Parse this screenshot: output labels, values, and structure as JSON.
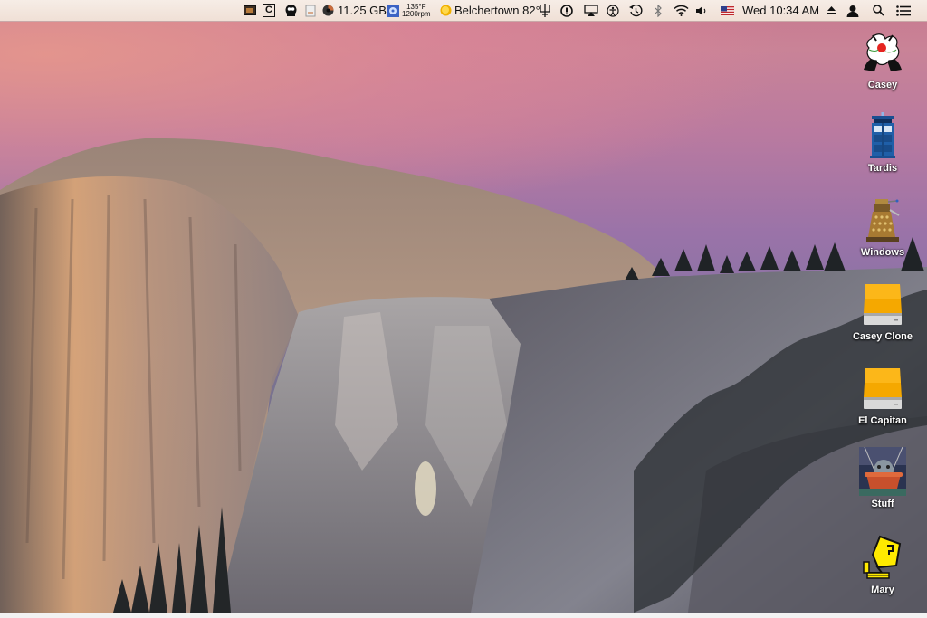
{
  "menubar": {
    "status_items": [
      {
        "name": "photo-app-icon"
      },
      {
        "name": "c-app-icon",
        "glyph": "C"
      },
      {
        "name": "monster-app-icon"
      },
      {
        "name": "document-app-icon"
      },
      {
        "name": "disk-usage-icon",
        "text": "11.25 GB"
      },
      {
        "name": "fan-icon",
        "temp": "135°F",
        "rpm": "1200rpm"
      },
      {
        "name": "weather-sun-icon",
        "text": "Belchertown 82°"
      },
      {
        "name": "ruler-app-icon"
      },
      {
        "name": "info-circle-icon"
      },
      {
        "name": "airplay-icon"
      },
      {
        "name": "accessibility-icon"
      },
      {
        "name": "time-machine-icon"
      },
      {
        "name": "bluetooth-icon"
      },
      {
        "name": "wifi-icon"
      },
      {
        "name": "volume-icon"
      },
      {
        "name": "us-flag-input-icon"
      }
    ],
    "clock": "Wed 10:34 AM",
    "eject_icon": "eject-icon",
    "user_icon": "user-icon",
    "spotlight_icon": "spotlight-search-icon",
    "notification_icon": "notification-center-icon"
  },
  "desktop": {
    "icons": [
      {
        "label": "Casey",
        "kind": "cartoon-cat"
      },
      {
        "label": "Tardis",
        "kind": "tardis"
      },
      {
        "label": "Windows",
        "kind": "dalek"
      },
      {
        "label": "Casey Clone",
        "kind": "external-drive"
      },
      {
        "label": "El Capitan",
        "kind": "external-drive"
      },
      {
        "label": "Stuff",
        "kind": "photo-chinchilla"
      },
      {
        "label": "Mary",
        "kind": "pixel-hand-pointer"
      }
    ],
    "colors": {
      "drive_orange": "#f5a800",
      "tardis_blue": "#1f5fa8",
      "mary_yellow": "#ffea00"
    }
  }
}
